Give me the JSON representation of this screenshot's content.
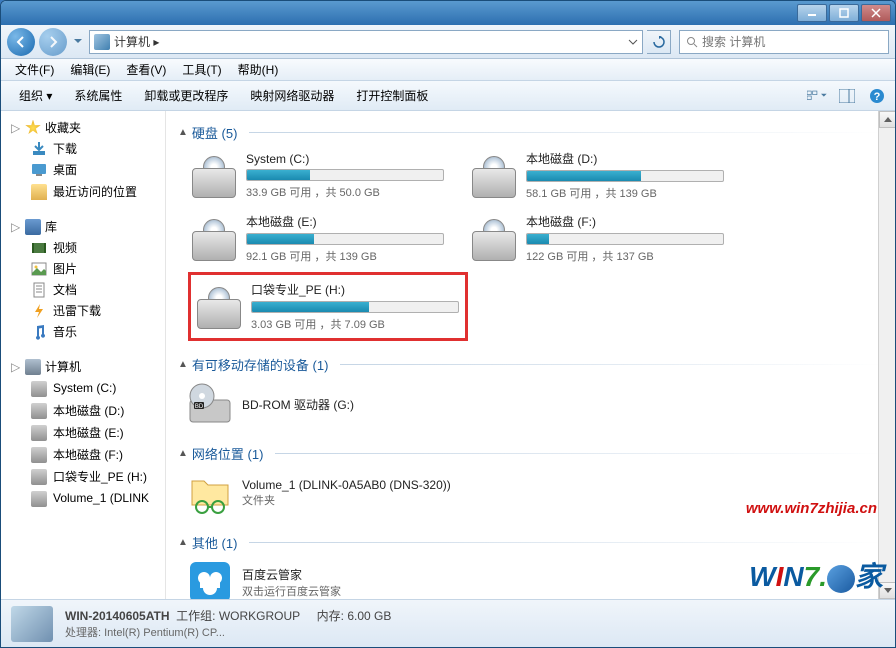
{
  "title": "",
  "address": {
    "path": "计算机 ▸",
    "search_placeholder": "搜索 计算机"
  },
  "menus": [
    "文件(F)",
    "编辑(E)",
    "查看(V)",
    "工具(T)",
    "帮助(H)"
  ],
  "toolbar": [
    "组织 ▾",
    "系统属性",
    "卸载或更改程序",
    "映射网络驱动器",
    "打开控制面板"
  ],
  "sidebar": {
    "favorites": {
      "label": "收藏夹",
      "items": [
        "下载",
        "桌面",
        "最近访问的位置"
      ]
    },
    "libraries": {
      "label": "库",
      "items": [
        "视频",
        "图片",
        "文档",
        "迅雷下载",
        "音乐"
      ]
    },
    "computer": {
      "label": "计算机",
      "items": [
        "System (C:)",
        "本地磁盘 (D:)",
        "本地磁盘 (E:)",
        "本地磁盘 (F:)",
        "口袋专业_PE (H:)",
        "Volume_1 (DLINK"
      ]
    }
  },
  "sections": {
    "drives": {
      "title": "硬盘 (5)",
      "items": [
        {
          "name": "System (C:)",
          "free": "33.9 GB 可用 ，共 50.0 GB",
          "pct": 32
        },
        {
          "name": "本地磁盘 (D:)",
          "free": "58.1 GB 可用 ，共 139 GB",
          "pct": 58
        },
        {
          "name": "本地磁盘 (E:)",
          "free": "92.1 GB 可用 ，共 139 GB",
          "pct": 34
        },
        {
          "name": "本地磁盘 (F:)",
          "free": "122 GB 可用 ，共 137 GB",
          "pct": 11
        },
        {
          "name": "口袋专业_PE (H:)",
          "free": "3.03 GB 可用 ，共 7.09 GB",
          "pct": 57,
          "highlight": true
        }
      ]
    },
    "removable": {
      "title": "有可移动存储的设备 (1)",
      "item": "BD-ROM 驱动器 (G:)"
    },
    "network": {
      "title": "网络位置 (1)",
      "item_name": "Volume_1 (DLINK-0A5AB0 (DNS-320))",
      "item_sub": "文件夹"
    },
    "other": {
      "title": "其他 (1)",
      "item_name": "百度云管家",
      "item_sub": "双击运行百度云管家"
    }
  },
  "status": {
    "computer_name": "WIN-20140605ATH",
    "workgroup_label": "工作组:",
    "workgroup": "WORKGROUP",
    "cpu_label": "处理器:",
    "cpu": "Intel(R) Pentium(R) CP...",
    "mem_label": "内存:",
    "mem": "6.00 GB"
  },
  "watermark": "www.win7zhijia.cn"
}
